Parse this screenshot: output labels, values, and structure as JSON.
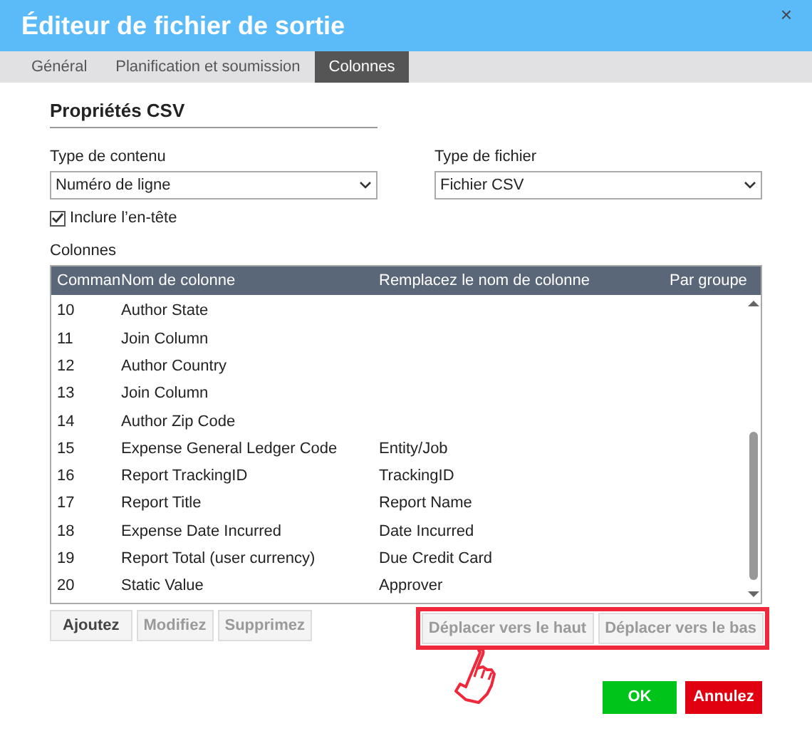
{
  "window": {
    "title": "Éditeur de fichier de sortie",
    "close": "×"
  },
  "tabs": [
    {
      "label": "Général",
      "selected": false
    },
    {
      "label": "Planification et soumission",
      "selected": false
    },
    {
      "label": "Colonnes",
      "selected": true
    }
  ],
  "section_title": "Propriétés CSV",
  "content_type": {
    "label": "Type de contenu",
    "value": "Numéro de ligne"
  },
  "file_type": {
    "label": "Type de fichier",
    "value": "Fichier CSV"
  },
  "include_header": {
    "label": "Inclure l’en-tête",
    "checked": true
  },
  "columns_label": "Colonnes",
  "table": {
    "columns": [
      "Comman",
      "Nom de colonne",
      "Remplacez le nom de colonne",
      "Par groupe"
    ],
    "rows": [
      {
        "order": "10",
        "name": "Author State"
      },
      {
        "order": "11",
        "name": "Join Column"
      },
      {
        "order": "12",
        "name": "Author Country"
      },
      {
        "order": "13",
        "name": "Join Column"
      },
      {
        "order": "14",
        "name": "Author Zip Code"
      },
      {
        "order": "15",
        "name": "Expense General Ledger Code",
        "rename": "Entity/Job"
      },
      {
        "order": "16",
        "name": "Report TrackingID",
        "rename": "TrackingID"
      },
      {
        "order": "17",
        "name": "Report Title",
        "rename": "Report Name"
      },
      {
        "order": "18",
        "name": "Expense Date Incurred",
        "rename": "Date Incurred"
      },
      {
        "order": "19",
        "name": "Report Total (user currency)",
        "rename": "Due Credit Card"
      },
      {
        "order": "20",
        "name": "Static Value",
        "rename": "Approver"
      }
    ]
  },
  "row_buttons": [
    {
      "label": "Ajoutez",
      "disabled": false
    },
    {
      "label": "Modifiez",
      "disabled": true
    },
    {
      "label": "Supprimez",
      "disabled": true
    }
  ],
  "move_buttons": [
    {
      "label": "Déplacer vers le haut",
      "disabled": true
    },
    {
      "label": "Déplacer vers le bas",
      "disabled": true
    }
  ],
  "dialog_buttons": [
    {
      "label": "OK",
      "kind": "ok"
    },
    {
      "label": "Annulez",
      "kind": "cancel"
    }
  ]
}
